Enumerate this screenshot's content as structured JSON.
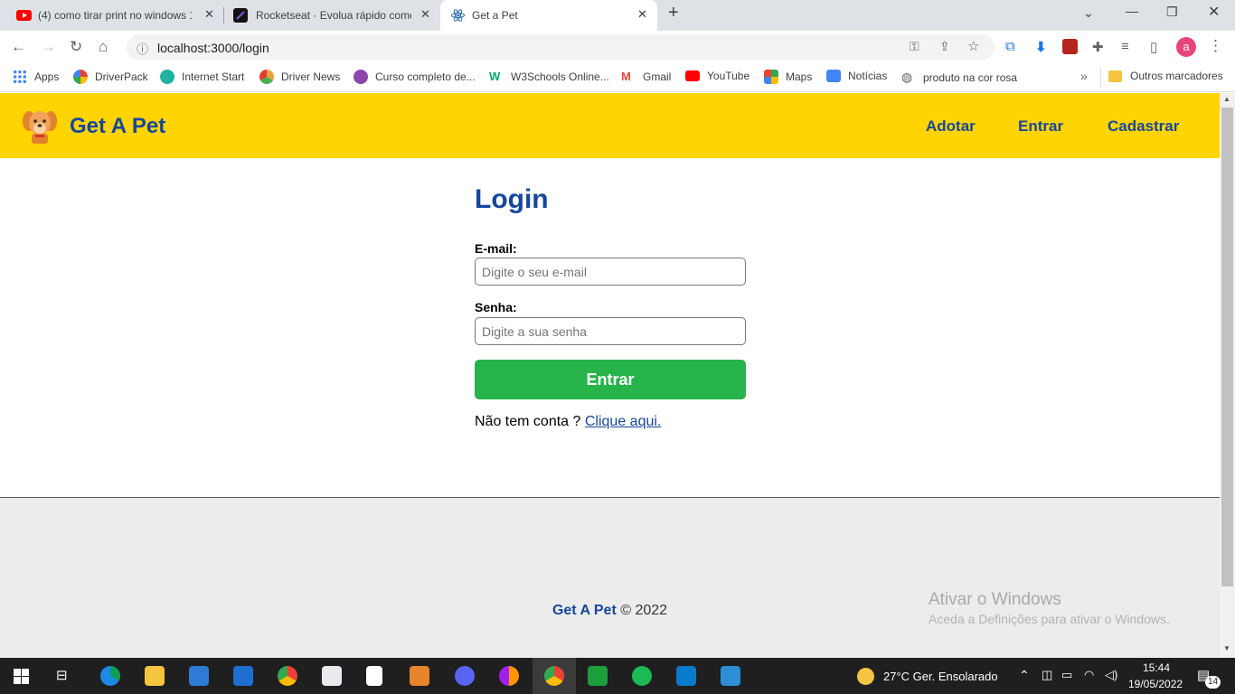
{
  "browser": {
    "tabs": [
      {
        "title": "(4) como tirar print no windows 1",
        "favicon": "youtube-icon"
      },
      {
        "title": "Rocketseat · Evolua rápido como",
        "favicon": "rocketseat-icon"
      },
      {
        "title": "Get a Pet",
        "favicon": "react-icon"
      }
    ],
    "new_tab_label": "+",
    "url": "localhost:3000/login",
    "profile_letter": "a",
    "bookmarks": [
      {
        "label": "Apps",
        "color": "#4285f4"
      },
      {
        "label": "DriverPack",
        "color": "#f4a300"
      },
      {
        "label": "Internet Start",
        "color": "#1fb3a0"
      },
      {
        "label": "Driver News",
        "color": "#e8a33d"
      },
      {
        "label": "Curso completo de...",
        "color": "#8e44ad"
      },
      {
        "label": "W3Schools Online...",
        "color": "#04aa6d"
      },
      {
        "label": "Gmail",
        "color": "#ea4335"
      },
      {
        "label": "YouTube",
        "color": "#ff0000"
      },
      {
        "label": "Maps",
        "color": "#34a853"
      },
      {
        "label": "Notícias",
        "color": "#4285f4"
      },
      {
        "label": "produto na cor rosa",
        "color": "#5f6368"
      }
    ],
    "other_bookmarks": "Outros marcadores"
  },
  "site": {
    "brand": "Get A Pet",
    "nav": [
      "Adotar",
      "Entrar",
      "Cadastrar"
    ],
    "login": {
      "title": "Login",
      "email_label": "E-mail:",
      "email_placeholder": "Digite o seu e-mail",
      "password_label": "Senha:",
      "password_placeholder": "Digite a sua senha",
      "submit": "Entrar",
      "signup_prompt": "Não tem conta ?",
      "signup_link": "Clique aqui."
    },
    "footer": {
      "brand": "Get A Pet",
      "copyright": "© 2022"
    }
  },
  "windows": {
    "activation_title": "Ativar o Windows",
    "activation_text": "Aceda a Definições para ativar o Windows.",
    "weather": "27°C  Ger. Ensolarado",
    "time": "15:44",
    "date": "19/05/2022",
    "notifications": "14"
  },
  "colors": {
    "navbar": "#ffd400",
    "brand_blue": "#16479d",
    "submit_green": "#25b34a",
    "footer_bg": "#ececec"
  }
}
